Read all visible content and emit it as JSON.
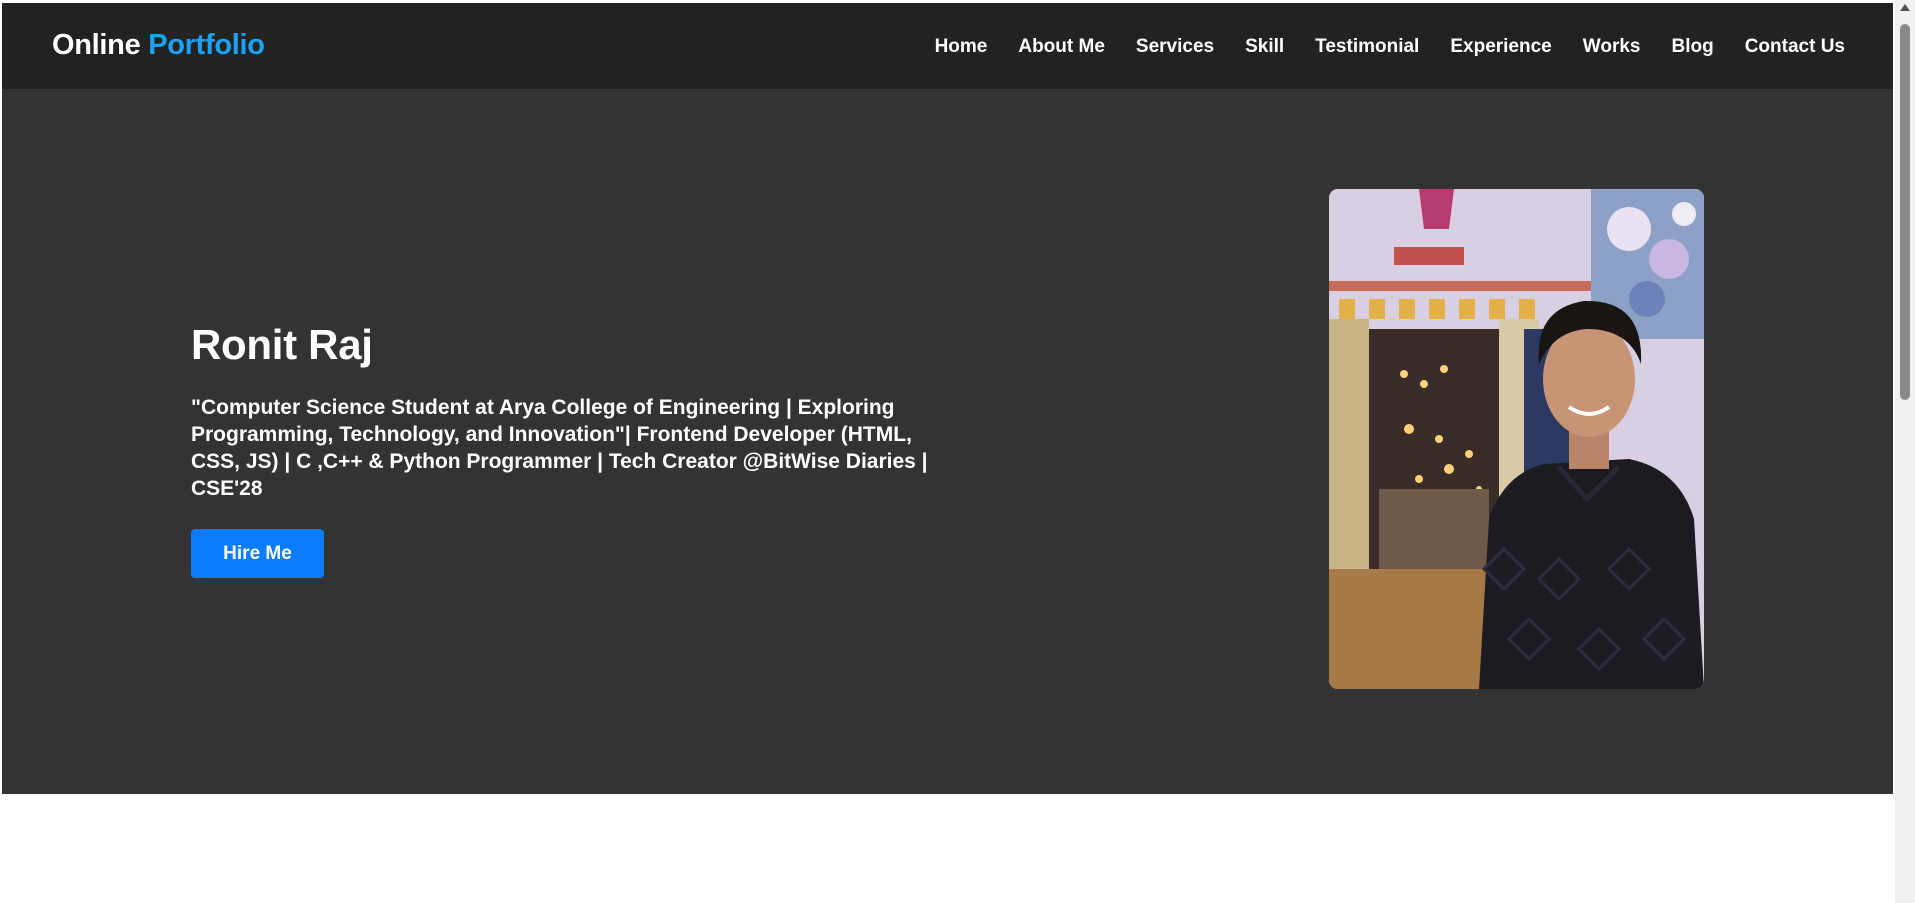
{
  "header": {
    "logo_primary": "Online",
    "logo_accent": "Portfolio",
    "nav": [
      {
        "label": "Home"
      },
      {
        "label": "About Me"
      },
      {
        "label": "Services"
      },
      {
        "label": "Skill"
      },
      {
        "label": "Testimonial"
      },
      {
        "label": "Experience"
      },
      {
        "label": "Works"
      },
      {
        "label": "Blog"
      },
      {
        "label": "Contact Us"
      }
    ]
  },
  "hero": {
    "name": "Ronit Raj",
    "tagline": "\"Computer Science Student at Arya College of Engineering | Exploring Programming, Technology, and Innovation\"| Frontend Developer (HTML, CSS, JS) | C ,C++ & Python Programmer | Tech Creator @BitWise Diaries | CSE'28",
    "cta_label": "Hire Me"
  },
  "colors": {
    "header_bg": "#222222",
    "hero_bg": "#333333",
    "accent": "#1da1f2",
    "button": "#0a7cff"
  }
}
